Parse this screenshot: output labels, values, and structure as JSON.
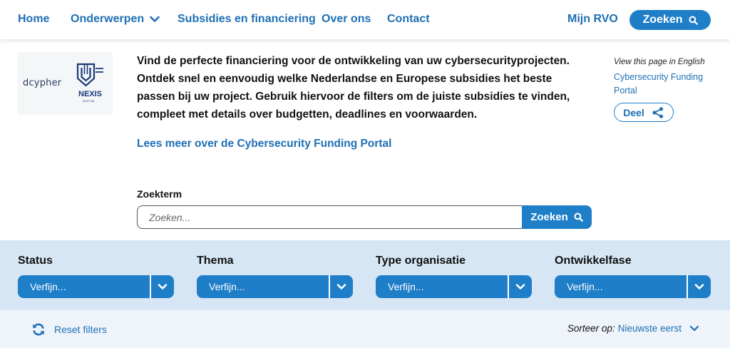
{
  "nav": {
    "home": "Home",
    "onderwerpen": "Onderwerpen",
    "subsidies": "Subsidies en financiering",
    "over_ons": "Over ons",
    "contact": "Contact",
    "mijn_rvo": "Mijn RVO",
    "search_label": "Zoeken"
  },
  "logos": {
    "decypher": "dcypher",
    "nexis": "NEXIS",
    "nexis_sub": "NCCT.NL"
  },
  "intro": {
    "text": "Vind de perfecte financiering voor de ontwikkeling van uw cybersecurityprojecten. Ontdek snel en eenvoudig welke Nederlandse en Europese subsidies het beste passen bij uw project. Gebruik hiervoor de filters om de juiste subsidies te vinden, compleet met details over budgetten, deadlines en voorwaarden.",
    "read_more": "Lees meer over de Cybersecurity Funding Portal"
  },
  "aside": {
    "english_label": "View this page in English",
    "english_link": "Cybersecurity Funding Portal",
    "share": "Deel"
  },
  "search": {
    "label": "Zoekterm",
    "placeholder": "Zoeken...",
    "button": "Zoeken"
  },
  "filters": [
    {
      "title": "Status",
      "value": "Verfijn..."
    },
    {
      "title": "Thema",
      "value": "Verfijn..."
    },
    {
      "title": "Type organisatie",
      "value": "Verfijn..."
    },
    {
      "title": "Ontwikkelfase",
      "value": "Verfijn..."
    }
  ],
  "footer_bar": {
    "reset": "Reset filters",
    "sort_label": "Sorteer op:",
    "sort_value": "Nieuwste eerst"
  },
  "colors": {
    "accent": "#1e7ec8",
    "link": "#1e6fb5",
    "filter_band": "#d6e6f4",
    "bottom_band": "#eef4fa"
  }
}
